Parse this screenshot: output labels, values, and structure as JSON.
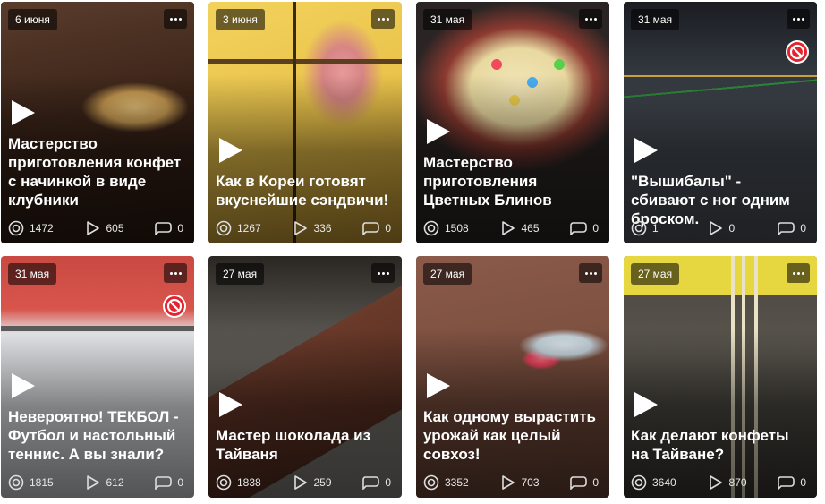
{
  "cards": [
    {
      "date": "6 июня",
      "title": "Мастерство приготовления конфет с начинкой в виде клубники",
      "views": "1472",
      "plays": "605",
      "comments": "0",
      "blocked": false
    },
    {
      "date": "3 июня",
      "title": "Как в Кореи готовят вкуснейшие сэндвичи!",
      "views": "1267",
      "plays": "336",
      "comments": "0",
      "blocked": false
    },
    {
      "date": "31 мая",
      "title": "Мастерство приготовления Цветных Блинов",
      "views": "1508",
      "plays": "465",
      "comments": "0",
      "blocked": false
    },
    {
      "date": "31 мая",
      "title": "\"Вышибалы\" - сбивают с ног одним броском.",
      "views": "1",
      "plays": "0",
      "comments": "0",
      "blocked": true
    },
    {
      "date": "31 мая",
      "title": "Невероятно! ТЕКБОЛ - Футбол и настольный теннис. А вы знали?",
      "views": "1815",
      "plays": "612",
      "comments": "0",
      "blocked": true
    },
    {
      "date": "27 мая",
      "title": "Мастер шоколада из Тайваня",
      "views": "1838",
      "plays": "259",
      "comments": "0",
      "blocked": false
    },
    {
      "date": "27 мая",
      "title": "Как одному вырастить урожай как целый совхоз!",
      "views": "3352",
      "plays": "703",
      "comments": "0",
      "blocked": false
    },
    {
      "date": "27 мая",
      "title": "Как делают конфеты на Тайване?",
      "views": "3640",
      "plays": "870",
      "comments": "0",
      "blocked": false
    }
  ],
  "icons": {
    "views": "eye-circle-icon",
    "plays": "play-triangle-icon",
    "comments": "speech-bubble-icon",
    "more": "more-dots-icon",
    "blocked": "no-entry-icon"
  }
}
